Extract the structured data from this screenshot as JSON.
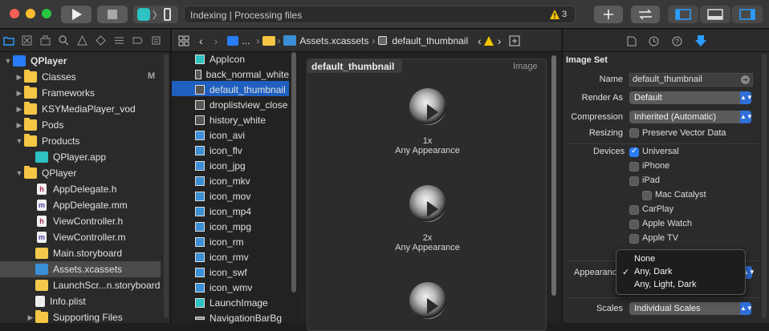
{
  "toolbar": {
    "scheme_label": "〉",
    "activity_text": "Indexing | Processing files",
    "warning_count": "3"
  },
  "navigator": {
    "items": [
      {
        "label": "QPlayer",
        "icon": "project-icon",
        "level": 0,
        "disc": "▼"
      },
      {
        "label": "Classes",
        "icon": "folder-icon",
        "level": 1,
        "disc": "▶",
        "badge": "M"
      },
      {
        "label": "Frameworks",
        "icon": "folder-icon",
        "level": 1,
        "disc": "▶"
      },
      {
        "label": "KSYMediaPlayer_vod",
        "icon": "folder-icon",
        "level": 1,
        "disc": "▶"
      },
      {
        "label": "Pods",
        "icon": "folder-icon",
        "level": 1,
        "disc": "▶"
      },
      {
        "label": "Products",
        "icon": "folder-icon",
        "level": 1,
        "disc": "▼"
      },
      {
        "label": "QPlayer.app",
        "icon": "app-icon",
        "level": 2,
        "disc": ""
      },
      {
        "label": "QPlayer",
        "icon": "folder-icon",
        "level": 1,
        "disc": "▼"
      },
      {
        "label": "AppDelegate.h",
        "icon": "h-file-icon",
        "level": 2,
        "disc": ""
      },
      {
        "label": "AppDelegate.mm",
        "icon": "m-file-icon",
        "level": 2,
        "disc": ""
      },
      {
        "label": "ViewController.h",
        "icon": "h-file-icon",
        "level": 2,
        "disc": ""
      },
      {
        "label": "ViewController.m",
        "icon": "m-file-icon",
        "level": 2,
        "disc": ""
      },
      {
        "label": "Main.storyboard",
        "icon": "storyboard-icon",
        "level": 2,
        "disc": ""
      },
      {
        "label": "Assets.xcassets",
        "icon": "assets-icon",
        "level": 2,
        "disc": "",
        "selected": true
      },
      {
        "label": "LaunchScr...n.storyboard",
        "icon": "storyboard-icon",
        "level": 2,
        "disc": ""
      },
      {
        "label": "Info.plist",
        "icon": "plist-icon",
        "level": 2,
        "disc": ""
      },
      {
        "label": "Supporting Files",
        "icon": "folder-icon",
        "level": 2,
        "disc": "▶"
      }
    ]
  },
  "jumpbar": {
    "ellipsis": "...",
    "assets": "Assets.xcassets",
    "current": "default_thumbnail"
  },
  "assets": [
    "AppIcon",
    "back_normal_white",
    "default_thumbnail",
    "droplistview_close",
    "history_white",
    "icon_avi",
    "icon_flv",
    "icon_jpg",
    "icon_mkv",
    "icon_mov",
    "icon_mp4",
    "icon_mpg",
    "icon_rm",
    "icon_rmv",
    "icon_swf",
    "icon_wmv",
    "LaunchImage",
    "NavigationBarBg"
  ],
  "canvas": {
    "title": "default_thumbnail",
    "kind": "Image",
    "slots": [
      {
        "scale": "1x",
        "appearance": "Any Appearance"
      },
      {
        "scale": "2x",
        "appearance": "Any Appearance"
      }
    ]
  },
  "inspector": {
    "section": "Image Set",
    "name_label": "Name",
    "name_value": "default_thumbnail",
    "render_label": "Render As",
    "render_value": "Default",
    "compression_label": "Compression",
    "compression_value": "Inherited (Automatic)",
    "resizing_label": "Resizing",
    "resizing_value": "Preserve Vector Data",
    "devices_label": "Devices",
    "devices": [
      {
        "label": "Universal",
        "checked": true
      },
      {
        "label": "iPhone",
        "checked": false
      },
      {
        "label": "iPad",
        "checked": false
      },
      {
        "label": "Mac Catalyst",
        "checked": false
      },
      {
        "label": "CarPlay",
        "checked": false
      },
      {
        "label": "Apple Watch",
        "checked": false
      },
      {
        "label": "Apple TV",
        "checked": false
      }
    ],
    "appearances_label": "Appearances",
    "scales_label": "Scales",
    "scales_value": "Individual Scales",
    "menu": {
      "options": [
        {
          "label": "None",
          "checked": false
        },
        {
          "label": "Any, Dark",
          "checked": true
        },
        {
          "label": "Any, Light, Dark",
          "checked": false
        }
      ]
    }
  },
  "colors": {
    "selection": "#1f5fbf",
    "accent": "#2a7cf6",
    "warning": "#f5c400"
  }
}
